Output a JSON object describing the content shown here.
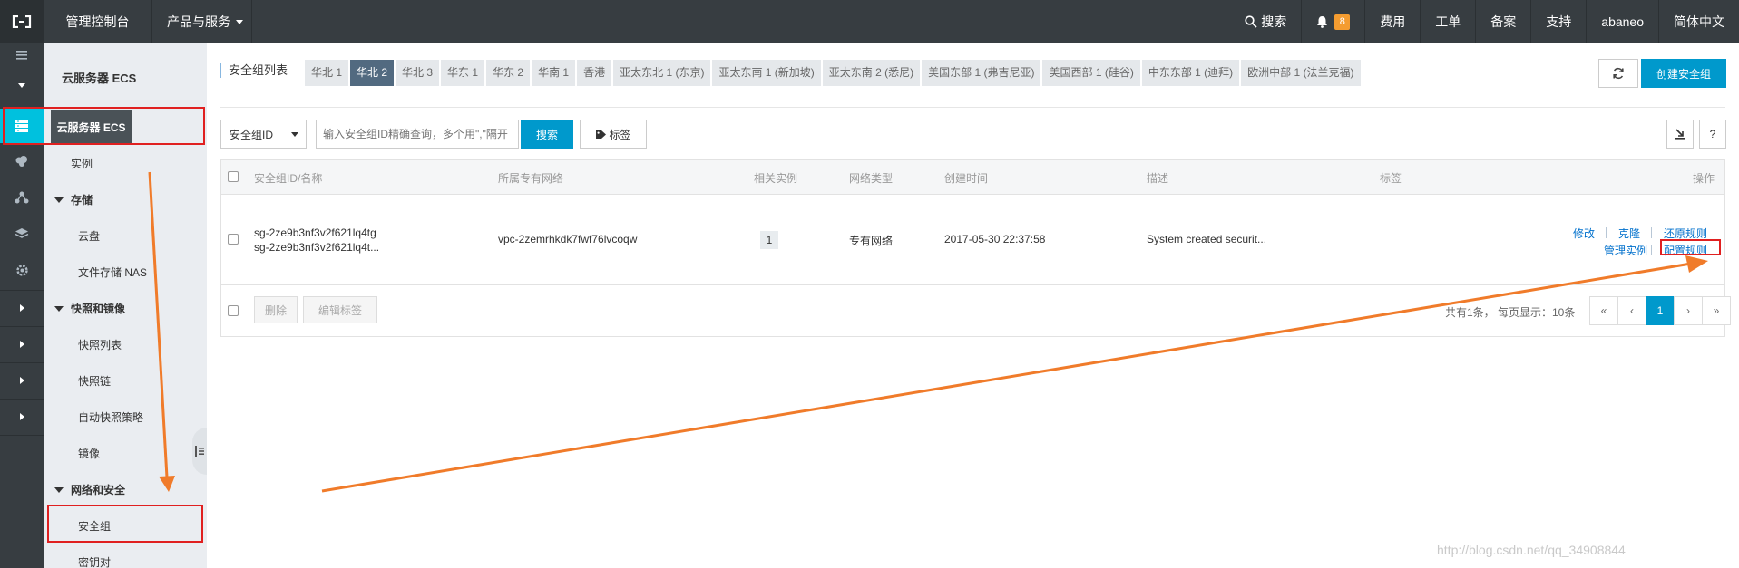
{
  "topbar": {
    "console": "管理控制台",
    "products": "产品与服务",
    "search": "搜索",
    "notifications_count": "8",
    "billing": "费用",
    "tickets": "工单",
    "icp": "备案",
    "support": "支持",
    "user": "abaneo",
    "language": "简体中文"
  },
  "sidebar": {
    "title": "云服务器 ECS",
    "tooltip": "云服务器 ECS",
    "instances": "实例",
    "storage_group": "存储",
    "disks": "云盘",
    "nas": "文件存储 NAS",
    "snapshot_group": "快照和镜像",
    "snapshot_list": "快照列表",
    "snapshot_chain": "快照链",
    "auto_snapshot": "自动快照策略",
    "images": "镜像",
    "network_group": "网络和安全",
    "security_groups": "安全组",
    "key_pairs": "密钥对"
  },
  "main": {
    "title": "安全组列表",
    "regions": [
      "华北 1",
      "华北 2",
      "华北 3",
      "华东 1",
      "华东 2",
      "华南 1",
      "香港",
      "亚太东北 1 (东京)",
      "亚太东南 1 (新加坡)",
      "亚太东南 2 (悉尼)",
      "美国东部 1 (弗吉尼亚)",
      "美国西部 1 (硅谷)",
      "中东东部 1 (迪拜)",
      "欧洲中部 1 (法兰克福)"
    ],
    "active_region": "华北 2",
    "create_button": "创建安全组",
    "filter_select": "安全组ID",
    "search_placeholder": "输入安全组ID精确查询，多个用\",\"隔开",
    "search_button": "搜索",
    "tag_button": "标签",
    "help": "?"
  },
  "table": {
    "headers": {
      "id_name": "安全组ID/名称",
      "vpc": "所属专有网络",
      "instances": "相关实例",
      "network_type": "网络类型",
      "created": "创建时间",
      "description": "描述",
      "tags": "标签",
      "actions": "操作"
    },
    "row": {
      "id": "sg-2ze9b3nf3v2f621lq4tg",
      "name": "sg-2ze9b3nf3v2f621lq4t...",
      "vpc": "vpc-2zemrhkdk7fwf76lvcoqw",
      "instances": "1",
      "network_type": "专有网络",
      "created": "2017-05-30 22:37:58",
      "description": "System created securit...",
      "action_edit": "修改",
      "action_clone": "克隆",
      "action_restore": "还原规则",
      "action_manage": "管理实例",
      "action_config": "配置规则"
    },
    "footer": {
      "delete": "删除",
      "edit_tags": "编辑标签",
      "summary": "共有1条， 每页显示：10条",
      "first": "«",
      "prev": "‹",
      "page": "1",
      "next": "›",
      "last": "»"
    }
  },
  "watermark": "http://blog.csdn.net/qq_34908844",
  "colors": {
    "topbar": "#373d41",
    "accent": "#00c1de",
    "primary": "#0099cc",
    "highlight": "#e02020",
    "arrow": "#f07b2a"
  }
}
